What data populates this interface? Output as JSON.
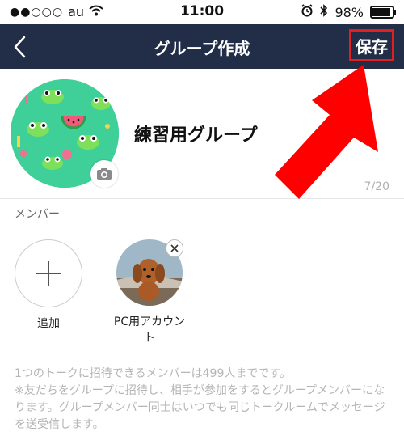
{
  "status_bar": {
    "signal": "●●○○○",
    "carrier": "au",
    "time": "11:00",
    "battery": "98%"
  },
  "header": {
    "title": "グループ作成",
    "save_label": "保存"
  },
  "group": {
    "name": "練習用グループ",
    "name_counter": "7/20"
  },
  "members": {
    "section_label": "メンバー",
    "add_label": "追加",
    "items": [
      {
        "name": "PC用アカウント"
      }
    ]
  },
  "note": {
    "line1": "1つのトークに招待できるメンバーは499人までです。",
    "line2": "※友だちをグループに招待し、相手が参加をするとグループメンバーになります。グループメンバー同士はいつでも同じトークルームでメッセージを送受信します。"
  },
  "colors": {
    "header_bg": "#222e48",
    "highlight": "#e02020",
    "avatar_bg": "#3fcf98"
  },
  "icons": [
    "back-chevron-icon",
    "wifi-icon",
    "alarm-icon",
    "bluetooth-icon",
    "battery-icon",
    "camera-icon",
    "plus-icon",
    "close-icon",
    "arrow-annotation"
  ]
}
